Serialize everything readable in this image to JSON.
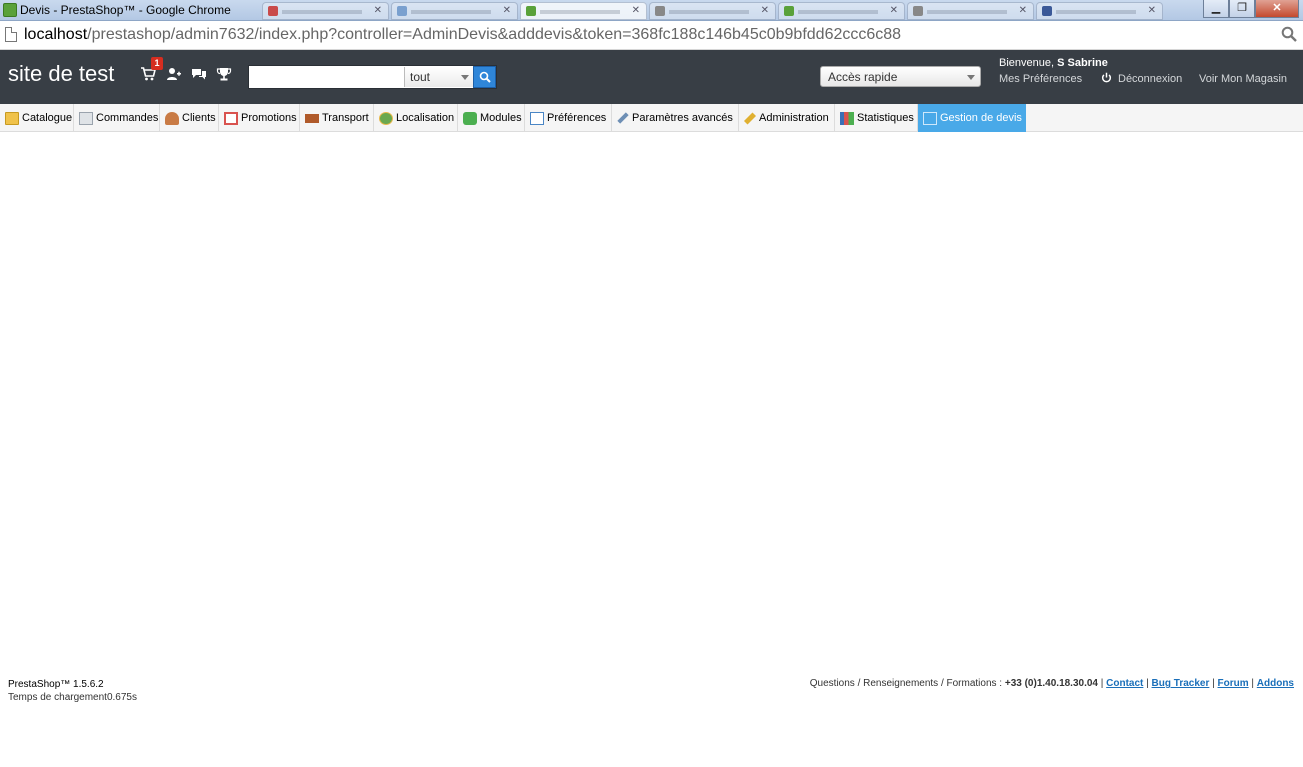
{
  "browser": {
    "window_title": "Devis - PrestaShop™ - Google Chrome",
    "url_host": "localhost",
    "url_path": "/prestashop/admin7632/index.php?controller=AdminDevis&adddevis&token=368fc188c146b45c0b9bfdd62ccc6c88"
  },
  "header": {
    "shop_name": "site de test",
    "orders_badge": "1",
    "search": {
      "value": "",
      "category": "tout"
    },
    "quick_access": "Accès rapide",
    "welcome_prefix": "Bienvenue, ",
    "user_name": "S Sabrine",
    "preferences_link": "Mes Préférences",
    "logout_link": "Déconnexion",
    "view_store_link": "Voir Mon Magasin"
  },
  "menu": {
    "items": [
      {
        "label": "Catalogue",
        "icon": "folder-icon",
        "color": "#f0c24a"
      },
      {
        "label": "Commandes",
        "icon": "cart-icon",
        "color": "#9aa3ad"
      },
      {
        "label": "Clients",
        "icon": "customer-icon",
        "color": "#c97b45"
      },
      {
        "label": "Promotions",
        "icon": "promotions-icon",
        "color": "#d9534f"
      },
      {
        "label": "Transport",
        "icon": "truck-icon",
        "color": "#b05a2a"
      },
      {
        "label": "Localisation",
        "icon": "globe-icon",
        "color": "#6aa84f"
      },
      {
        "label": "Modules",
        "icon": "puzzle-icon",
        "color": "#4caf50"
      },
      {
        "label": "Préférences",
        "icon": "preferences-icon",
        "color": "#4a86c5"
      },
      {
        "label": "Paramètres avancés",
        "icon": "wrench-icon",
        "color": "#6e8fb5"
      },
      {
        "label": "Administration",
        "icon": "key-icon",
        "color": "#e0b030"
      },
      {
        "label": "Statistiques",
        "icon": "chart-icon",
        "color": "#3b6fb6"
      },
      {
        "label": "Gestion de devis",
        "icon": "devis-icon",
        "color": "#49a9e8"
      }
    ],
    "active": "Gestion de devis"
  },
  "footer": {
    "version": "PrestaShop™ 1.5.6.2",
    "load_time": "Temps de chargement0.675s",
    "questions": "Questions / Renseignements / Formations : ",
    "phone": "+33 (0)1.40.18.30.04",
    "links": [
      "Contact",
      "Bug Tracker",
      "Forum",
      "Addons"
    ]
  }
}
